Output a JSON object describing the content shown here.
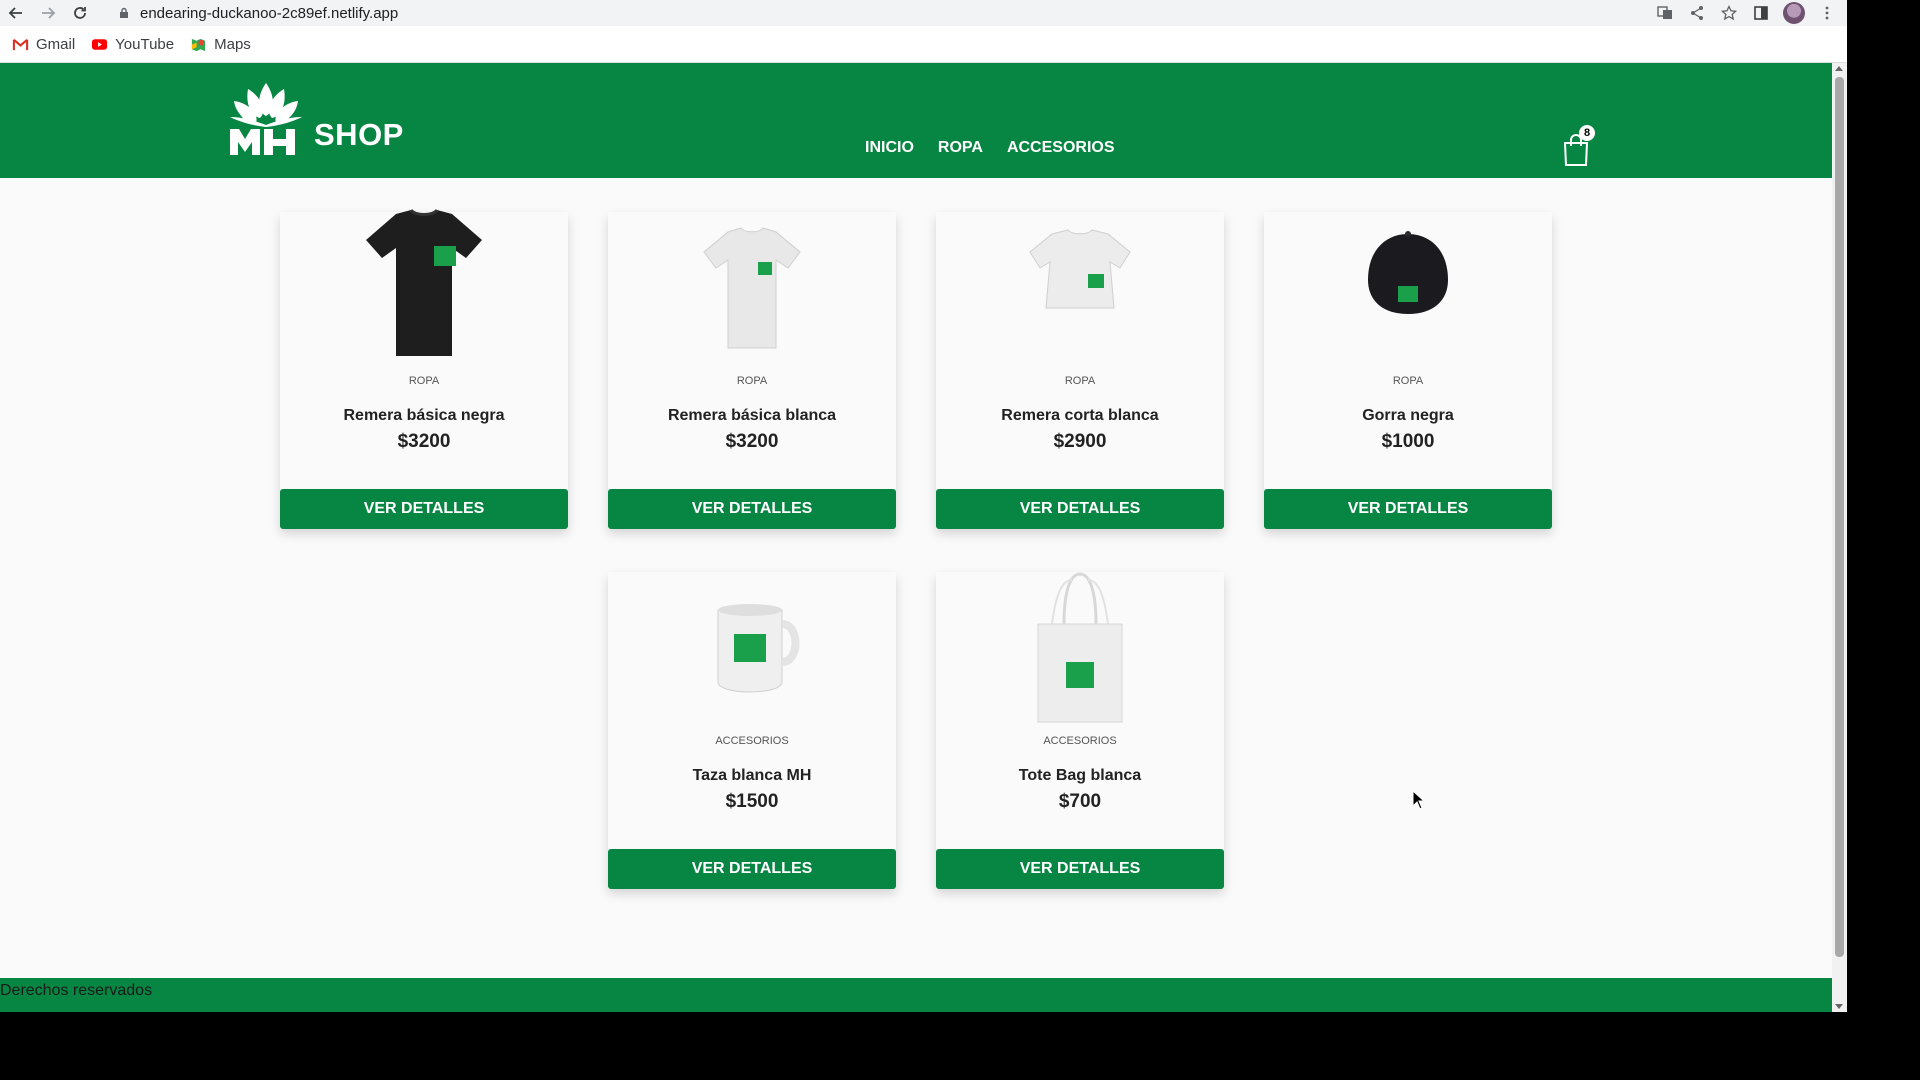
{
  "browser": {
    "url": "endearing-duckanoo-2c89ef.netlify.app",
    "bookmarks": [
      {
        "label": "Gmail",
        "icon": "gmail-icon"
      },
      {
        "label": "YouTube",
        "icon": "youtube-icon"
      },
      {
        "label": "Maps",
        "icon": "maps-icon"
      }
    ]
  },
  "header": {
    "logo_text": "SHOP",
    "nav": [
      "INICIO",
      "ROPA",
      "ACCESORIOS"
    ],
    "cart_count": "8"
  },
  "products": [
    {
      "category": "ROPA",
      "title": "Remera básica negra",
      "price": "$3200",
      "button": "VER DETALLES",
      "image": "black-tshirt"
    },
    {
      "category": "ROPA",
      "title": "Remera básica blanca",
      "price": "$3200",
      "button": "VER DETALLES",
      "image": "white-tshirt"
    },
    {
      "category": "ROPA",
      "title": "Remera corta blanca",
      "price": "$2900",
      "button": "VER DETALLES",
      "image": "white-crop-top"
    },
    {
      "category": "ROPA",
      "title": "Gorra negra",
      "price": "$1000",
      "button": "VER DETALLES",
      "image": "black-cap"
    },
    {
      "category": "ACCESORIOS",
      "title": "Taza blanca MH",
      "price": "$1500",
      "button": "VER DETALLES",
      "image": "white-mug"
    },
    {
      "category": "ACCESORIOS",
      "title": "Tote Bag blanca",
      "price": "$700",
      "button": "VER DETALLES",
      "image": "tote-bag"
    }
  ],
  "footer": {
    "text": "Derechos reservados"
  },
  "colors": {
    "brand_green": "#068642",
    "page_bg": "#fafafa"
  }
}
